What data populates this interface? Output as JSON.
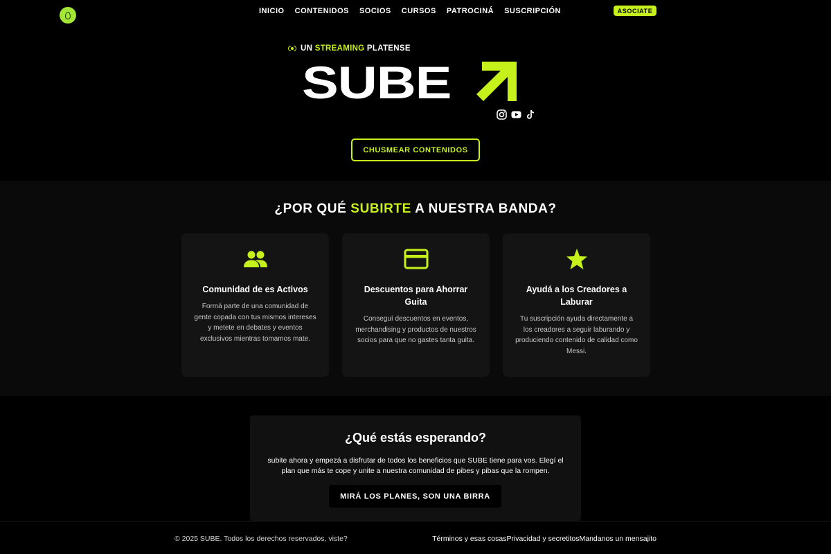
{
  "nav": {
    "logo_icon": "drop-icon",
    "items": [
      {
        "label": "INICIO"
      },
      {
        "label": "CONTENIDOS"
      },
      {
        "label": "SOCIOS"
      },
      {
        "label": "CURSOS"
      },
      {
        "label": "PATROCINÁ"
      },
      {
        "label": "SUSCRIPCIÓN"
      }
    ],
    "cta_label": "ASOCIATE"
  },
  "hero": {
    "kicker_pre": "UN",
    "kicker_highlight": "STREAMING",
    "kicker_post": "PLATENSE",
    "brand": "SUBE",
    "socials": [
      "instagram-icon",
      "youtube-icon",
      "tiktok-icon"
    ],
    "button_label": "CHUSMEAR CONTENIDOS"
  },
  "features": {
    "title_pre": "¿POR QUÉ",
    "title_highlight": "SUBIRTE",
    "title_post": "A NUESTRA BANDA?",
    "cards": [
      {
        "icon": "users-icon",
        "title": "Comunidad de es Activos",
        "text": "Formá parte de una comunidad de gente copada con tus mismos intereses y metete en debates y eventos exclusivos mientras tomamos mate."
      },
      {
        "icon": "credit-card-icon",
        "title": "Descuentos para Ahorrar Guita",
        "text": "Conseguí descuentos en eventos, merchandising y productos de nuestros socios para que no gastes tanta guita."
      },
      {
        "icon": "star-icon",
        "title": "Ayudá a los Creadores a Laburar",
        "text": "Tu suscripción ayuda directamente a los creadores a seguir laburando y produciendo contenido de calidad como Messi."
      }
    ]
  },
  "cta": {
    "title": "¿Qué estás esperando?",
    "text": "subite ahora y empezá a disfrutar de todos los beneficios que SUBE tiene para vos. Elegí el plan que más te cope y unite a nuestra comunidad de pibes y pibas que la rompen.",
    "button_label": "MIRÁ LOS PLANES, SON UNA BIRRA"
  },
  "footer": {
    "copyright": "© 2025 SUBE. Todos los derechos reservados, viste?",
    "links": [
      {
        "label": "Términos y esas cosas"
      },
      {
        "label": "Privacidad y secretitos"
      },
      {
        "label": "Mandanos un mensajito"
      }
    ]
  },
  "colors": {
    "accent": "#c6f11a",
    "background": "#000000",
    "section_bg": "#0a0a0a",
    "card_bg": "#141414"
  }
}
